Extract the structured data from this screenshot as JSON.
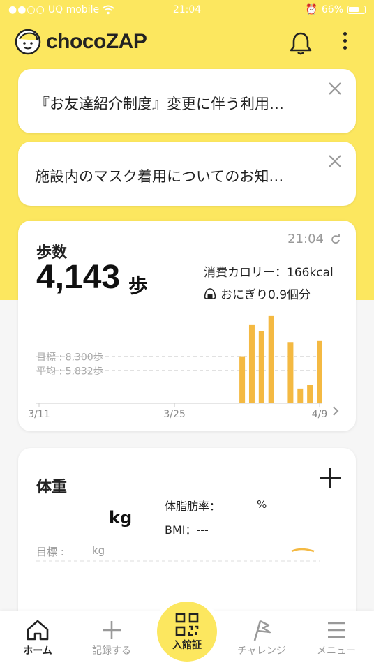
{
  "status_bar": {
    "carrier": "UQ mobile",
    "time": "21:04",
    "battery": "66%"
  },
  "header": {
    "logo_text": "chocoZAP"
  },
  "notices": [
    {
      "text": "『お友達紹介制度』変更に伴う利用…"
    },
    {
      "text": "施設内のマスク着用についてのお知…"
    }
  ],
  "steps": {
    "title": "歩数",
    "value": "4,143",
    "unit": "歩",
    "updated_time": "21:04",
    "calories": "消費カロリー：166kcal",
    "onigiri": "おにぎり0.9個分",
    "goal": "目標 : 8,300歩",
    "average": "平均 : 5,832歩"
  },
  "chart_data": {
    "type": "bar",
    "x_tick_labels": [
      "3/11",
      "3/25",
      "4/9"
    ],
    "values": [
      0,
      0,
      0,
      0,
      0,
      0,
      0,
      0,
      0,
      0,
      0,
      0,
      0,
      0,
      0,
      0,
      0,
      0,
      0,
      0,
      0,
      8300,
      13800,
      12800,
      15400,
      0,
      10800,
      2600,
      3200,
      11100
    ],
    "goal": 8300,
    "average": 5832,
    "ylim": [
      0,
      16000
    ],
    "bar_color": "#f4b942"
  },
  "weight": {
    "title": "体重",
    "unit": "kg",
    "body_fat_label": "体脂肪率：",
    "body_fat_unit": "%",
    "bmi": "BMI：---",
    "goal_label": "目標 :",
    "goal_unit": "kg"
  },
  "tabs": [
    {
      "label": "ホーム",
      "active": true
    },
    {
      "label": "記録する"
    },
    {
      "label": "チャレンジ"
    },
    {
      "label": "メニュー"
    }
  ],
  "center_button": {
    "label": "入館証"
  },
  "colors": {
    "brand_yellow": "#fce75f",
    "bar": "#f4b942"
  }
}
